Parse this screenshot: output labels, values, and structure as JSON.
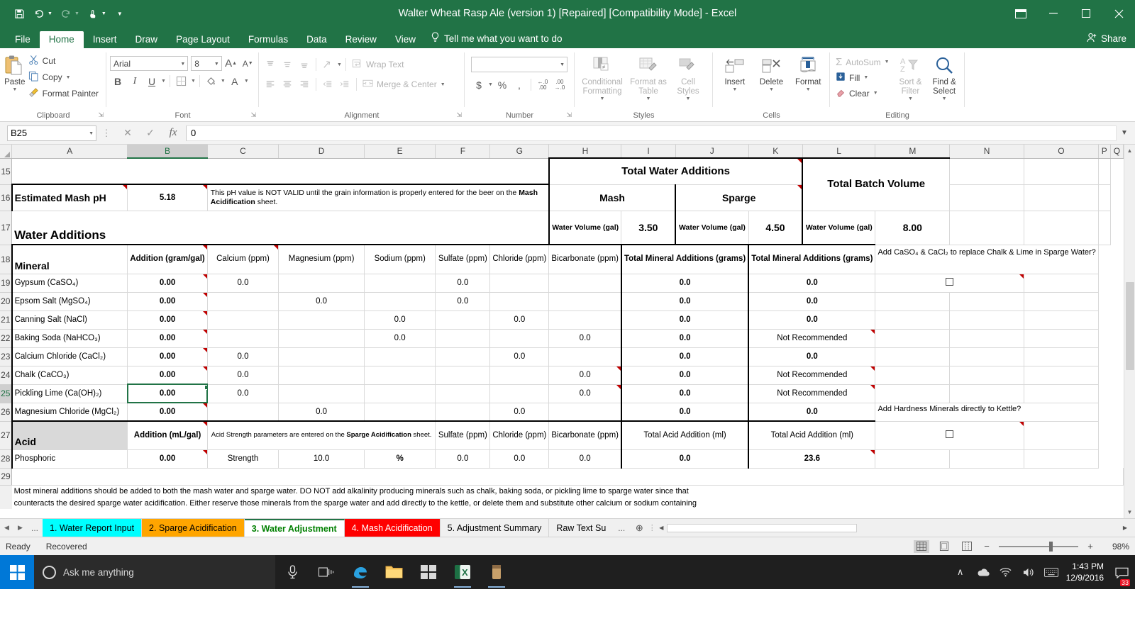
{
  "titlebar": {
    "title": "Walter Wheat Rasp Ale (version 1) [Repaired]  [Compatibility Mode]  -  Excel",
    "save_icon": "save-icon",
    "undo_icon": "undo-icon",
    "redo_icon": "redo-icon",
    "touch_icon": "touch-mode-icon",
    "more_icon": "more-icon",
    "ribbon_display_icon": "ribbon-display-options-icon",
    "minimize": "–",
    "maximize": "☐",
    "close": "✕"
  },
  "ribbon": {
    "tabs": [
      {
        "label": "File",
        "active": false
      },
      {
        "label": "Home",
        "active": true
      },
      {
        "label": "Insert",
        "active": false
      },
      {
        "label": "Draw",
        "active": false
      },
      {
        "label": "Page Layout",
        "active": false
      },
      {
        "label": "Formulas",
        "active": false
      },
      {
        "label": "Data",
        "active": false
      },
      {
        "label": "Review",
        "active": false
      },
      {
        "label": "View",
        "active": false
      }
    ],
    "tellme": "Tell me what you want to do",
    "share": "Share",
    "groups": {
      "clipboard": {
        "label": "Clipboard",
        "paste": "Paste",
        "cut": "Cut",
        "copy": "Copy",
        "format_painter": "Format Painter"
      },
      "font": {
        "label": "Font",
        "font_name": "Arial",
        "font_size": "8",
        "grow": "A",
        "shrink": "A",
        "bold": "B",
        "italic": "I",
        "underline": "U"
      },
      "alignment": {
        "label": "Alignment",
        "wrap_text": "Wrap Text",
        "merge_center": "Merge & Center"
      },
      "number": {
        "label": "Number",
        "format_value": "",
        "currency": "$",
        "percent": "%",
        "comma": ",",
        "increase_decimal": ".00",
        "decrease_decimal": ".00"
      },
      "styles": {
        "label": "Styles",
        "conditional_formatting": "Conditional Formatting",
        "format_as_table": "Format as Table",
        "cell_styles": "Cell Styles"
      },
      "cells": {
        "label": "Cells",
        "insert": "Insert",
        "delete": "Delete",
        "format": "Format"
      },
      "editing": {
        "label": "Editing",
        "autosum": "AutoSum",
        "fill": "Fill",
        "clear": "Clear",
        "sort_filter": "Sort & Filter",
        "find_select": "Find & Select"
      }
    }
  },
  "formula_bar": {
    "name_box": "B25",
    "cancel_icon": "cancel-icon",
    "enter_icon": "enter-icon",
    "fx_icon": "insert-function-icon",
    "value": "0"
  },
  "grid": {
    "columns": [
      "A",
      "B",
      "C",
      "D",
      "E",
      "F",
      "G",
      "H",
      "I",
      "J",
      "K",
      "L",
      "M",
      "N",
      "O",
      "P",
      "Q"
    ],
    "selected_column": "B",
    "selected_row": "25",
    "row_numbers": [
      "15",
      "16",
      "17",
      "18",
      "19",
      "20",
      "21",
      "22",
      "23",
      "24",
      "25",
      "26",
      "27",
      "28",
      "29"
    ],
    "headers": {
      "total_water_additions": "Total Water Additions",
      "total_batch_volume": "Total Batch Volume",
      "mash": "Mash",
      "sparge": "Sparge",
      "water_volume_label": "Water Volume (gal)",
      "mash_volume": "3.50",
      "sparge_volume": "4.50",
      "batch_volume": "8.00"
    },
    "estimated_mash_ph": {
      "label": "Estimated Mash pH",
      "value": "5.18",
      "warning_prefix": "This pH value is NOT VALID until the grain information is properly entered for the beer on the ",
      "warning_bold": "Mash Acidification",
      "warning_suffix": " sheet."
    },
    "water_additions_title": "Water Additions",
    "mineral_table": {
      "headers": [
        "Mineral",
        "Addition (gram/gal)",
        "Calcium (ppm)",
        "Magnesium (ppm)",
        "Sodium (ppm)",
        "Sulfate (ppm)",
        "Chloride (ppm)",
        "Bicarbonate (ppm)",
        "Total Mineral Additions (grams)",
        "Total Mineral Additions (grams)"
      ],
      "rows": [
        {
          "name": "Gypsum (CaSO₄)",
          "addition": "0.00",
          "calcium": "0.0",
          "magnesium": "",
          "sodium": "",
          "sulfate": "0.0",
          "chloride": "",
          "bicarbonate": "",
          "mash_total": "0.0",
          "sparge_total": "0.0"
        },
        {
          "name": "Epsom Salt (MgSO₄)",
          "addition": "0.00",
          "calcium": "",
          "magnesium": "0.0",
          "sodium": "",
          "sulfate": "0.0",
          "chloride": "",
          "bicarbonate": "",
          "mash_total": "0.0",
          "sparge_total": "0.0"
        },
        {
          "name": "Canning Salt (NaCl)",
          "addition": "0.00",
          "calcium": "",
          "magnesium": "",
          "sodium": "0.0",
          "sulfate": "",
          "chloride": "0.0",
          "bicarbonate": "",
          "mash_total": "0.0",
          "sparge_total": "0.0"
        },
        {
          "name": "Baking Soda (NaHCO₃)",
          "addition": "0.00",
          "calcium": "",
          "magnesium": "",
          "sodium": "0.0",
          "sulfate": "",
          "chloride": "",
          "bicarbonate": "0.0",
          "mash_total": "0.0",
          "sparge_total": "Not Recommended"
        },
        {
          "name": "Calcium Chloride (CaCl₂)",
          "addition": "0.00",
          "calcium": "0.0",
          "magnesium": "",
          "sodium": "",
          "sulfate": "",
          "chloride": "0.0",
          "bicarbonate": "",
          "mash_total": "0.0",
          "sparge_total": "0.0"
        },
        {
          "name": "Chalk (CaCO₃)",
          "addition": "0.00",
          "calcium": "0.0",
          "magnesium": "",
          "sodium": "",
          "sulfate": "",
          "chloride": "",
          "bicarbonate": "0.0",
          "mash_total": "0.0",
          "sparge_total": "Not Recommended"
        },
        {
          "name": "Pickling Lime (Ca(OH)₂)",
          "addition": "0.00",
          "calcium": "0.0",
          "magnesium": "",
          "sodium": "",
          "sulfate": "",
          "chloride": "",
          "bicarbonate": "0.0",
          "mash_total": "0.0",
          "sparge_total": "Not Recommended"
        },
        {
          "name": "Magnesium Chloride (MgCl₂)",
          "addition": "0.00",
          "calcium": "",
          "magnesium": "0.0",
          "sodium": "",
          "sulfate": "",
          "chloride": "0.0",
          "bicarbonate": "",
          "mash_total": "0.0",
          "sparge_total": "0.0"
        }
      ]
    },
    "acid_table": {
      "headers": [
        "Acid",
        "Addition (mL/gal)",
        "Sulfate (ppm)",
        "Chloride (ppm)",
        "Bicarbonate (ppm)",
        "Total Acid Addition (ml)",
        "Total Acid Addition (ml)"
      ],
      "acid_strength_note_prefix": "Acid Strength parameters are entered on the ",
      "acid_strength_note_bold": "Sparge Acidification",
      "acid_strength_note_suffix": " sheet.",
      "row": {
        "name": "Phosphoric",
        "addition": "0.00",
        "strength_label": "Strength",
        "strength_value": "10.0",
        "strength_unit": "%",
        "sulfate": "0.0",
        "chloride": "0.0",
        "bicarbonate": "0.0",
        "mash_total": "0.0",
        "sparge_total": "23.6"
      }
    },
    "checkboxes": {
      "replace_chalk_lime": "Add CaSO₄ & CaCl₂ to replace Chalk & Lime in Sparge Water?",
      "hardness_to_kettle": "Add Hardness Minerals directly to Kettle?"
    },
    "footer_note_line1": "Most mineral additions should be added to both the mash water and sparge water.  DO NOT add alkalinity producing minerals such as chalk, baking soda, or pickling lime to sparge water since that",
    "footer_note_line2": "counteracts the desired sparge water acidification.  Either reserve those minerals from the sparge water and add directly to the kettle, or delete them and substitute other calcium or sodium containing"
  },
  "sheet_tabs": {
    "tabs": [
      {
        "label": "1. Water Report Input",
        "color": "#00ffff",
        "active": false
      },
      {
        "label": "2. Sparge Acidification",
        "color": "#ffa500",
        "active": false
      },
      {
        "label": "3. Water Adjustment",
        "color": "#008000",
        "active": true
      },
      {
        "label": "4. Mash Acidification",
        "color": "#ff0000",
        "active": false
      },
      {
        "label": "5. Adjustment Summary",
        "color": "",
        "active": false
      },
      {
        "label": "Raw Text Su",
        "color": "",
        "active": false
      }
    ],
    "overflow": "...",
    "add_sheet": "+"
  },
  "status_bar": {
    "left": "Ready",
    "recovered": "Recovered",
    "views": [
      "normal-view-icon",
      "page-layout-icon",
      "page-break-icon"
    ],
    "zoom_out": "−",
    "zoom_in": "+",
    "zoom_level": "98%"
  },
  "taskbar": {
    "start_icon": "windows-start-icon",
    "search_placeholder": "Ask me anything",
    "cortana_icon": "cortana-icon",
    "pinned": [
      "microphone-icon",
      "task-view-icon",
      "edge-browser-icon",
      "file-explorer-icon",
      "store-icon",
      "excel-icon",
      "app-icon"
    ],
    "tray_icons": [
      "show-hidden-icons-icon",
      "onedrive-icon",
      "network-icon",
      "volume-icon",
      "keyboard-icon"
    ],
    "time": "1:43 PM",
    "date": "12/9/2016",
    "notification_count": "33"
  },
  "colors": {
    "excel_green": "#217346",
    "highlight_yellow": "#ffff00",
    "input_cyan": "#cffcfc",
    "warn_orange": "#ffc000",
    "header_gray": "#a6a6a6"
  }
}
